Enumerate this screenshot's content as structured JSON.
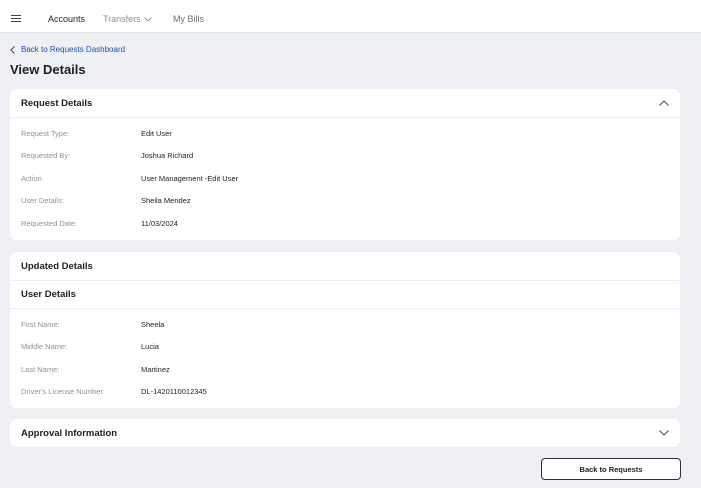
{
  "nav": {
    "accounts": "Accounts",
    "transfers": "Transfers",
    "bills": "My Bills"
  },
  "back_link": "Back to Requests Dashboard",
  "page_title": "View Details",
  "request_details": {
    "title": "Request Details",
    "rows": [
      {
        "label": "Request Type:",
        "value": "Edit User"
      },
      {
        "label": "Requested By:",
        "value": "Joshua Richard"
      },
      {
        "label": "Action",
        "value": "User Management -Edit User"
      },
      {
        "label": "User Details:",
        "value": "Sheila Mendez"
      },
      {
        "label": "Requested Date:",
        "value": "11/03/2024"
      }
    ]
  },
  "updated_details": {
    "title": "Updated Details",
    "subtitle": "User Details",
    "rows": [
      {
        "label": "First Name:",
        "value": "Sheela"
      },
      {
        "label": "Middle Name:",
        "value": "Lucia"
      },
      {
        "label": "Last Name:",
        "value": "Martinez"
      },
      {
        "label": "Driver's License Number:",
        "value": "DL-1420110012345"
      }
    ]
  },
  "approval": {
    "title": "Approval Information"
  },
  "back_button": "Back to Requests",
  "icons": {
    "menu": "hamburger-menu-icon",
    "transfers_dropdown": "chevron-down-icon",
    "back": "chevron-left-icon",
    "collapse": "chevron-up-icon",
    "expand": "chevron-down-icon"
  },
  "colors": {
    "background": "#eef0f3",
    "link": "#1f4fae",
    "text": "#1b1f24",
    "label": "#8c9199"
  }
}
